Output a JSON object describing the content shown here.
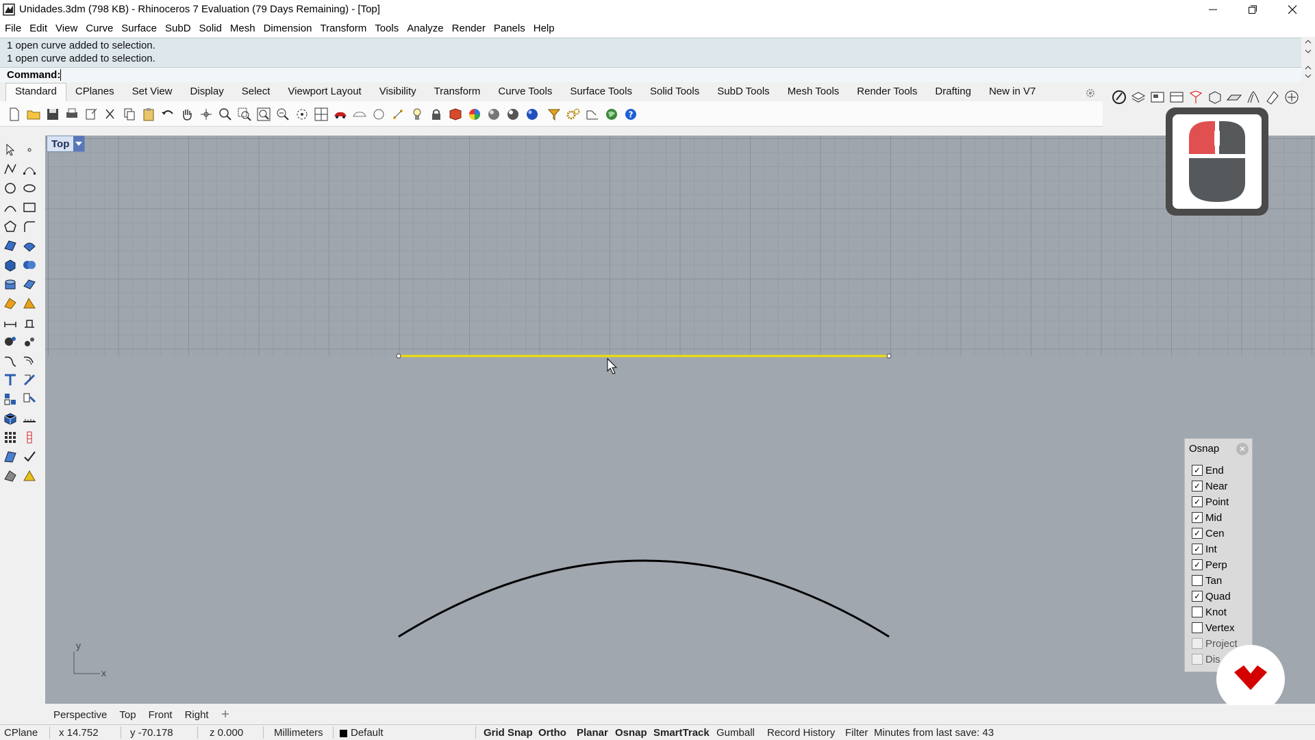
{
  "window": {
    "title": "Unidades.3dm (798 KB) - Rhinoceros 7 Evaluation (79 Days Remaining) - [Top]",
    "minimize_icon": "minimize-icon",
    "restore_icon": "restore-icon",
    "close_icon": "close-icon"
  },
  "menu": [
    "File",
    "Edit",
    "View",
    "Curve",
    "Surface",
    "SubD",
    "Solid",
    "Mesh",
    "Dimension",
    "Transform",
    "Tools",
    "Analyze",
    "Render",
    "Panels",
    "Help"
  ],
  "command": {
    "history": [
      "1 open curve added to selection.",
      "1 open curve added to selection."
    ],
    "label": "Command:",
    "value": ""
  },
  "toolbar_tabs": [
    "Standard",
    "CPlanes",
    "Set View",
    "Display",
    "Select",
    "Viewport Layout",
    "Visibility",
    "Transform",
    "Curve Tools",
    "Surface Tools",
    "Solid Tools",
    "SubD Tools",
    "Mesh Tools",
    "Render Tools",
    "Drafting",
    "New in V7"
  ],
  "active_toolbar_tab": "Standard",
  "viewport": {
    "label": "Top",
    "axis_x": "x",
    "axis_y": "y"
  },
  "osnap": {
    "title": "Osnap",
    "items": [
      {
        "label": "End",
        "checked": true
      },
      {
        "label": "Near",
        "checked": true
      },
      {
        "label": "Point",
        "checked": true
      },
      {
        "label": "Mid",
        "checked": true
      },
      {
        "label": "Cen",
        "checked": true
      },
      {
        "label": "Int",
        "checked": true
      },
      {
        "label": "Perp",
        "checked": true
      },
      {
        "label": "Tan",
        "checked": false
      },
      {
        "label": "Quad",
        "checked": true
      },
      {
        "label": "Knot",
        "checked": false
      },
      {
        "label": "Vertex",
        "checked": false
      },
      {
        "label": "Project",
        "checked": false,
        "disabled": true
      },
      {
        "label": "Dis",
        "checked": false,
        "disabled": true
      }
    ]
  },
  "view_tabs": [
    "Perspective",
    "Top",
    "Front",
    "Right"
  ],
  "status": {
    "cplane": "CPlane",
    "x": "x 14.752",
    "y": "y -70.178",
    "z": "z 0.000",
    "units": "Millimeters",
    "layer": "Default",
    "grid_snap": "Grid Snap",
    "ortho": "Ortho",
    "planar": "Planar",
    "osnap": "Osnap",
    "smarttrack": "SmartTrack",
    "gumball": "Gumball",
    "record_history": "Record History",
    "filter": "Filter",
    "save_info": "Minutes from last save: 43"
  },
  "colors": {
    "viewport_bg": "#a1a7af",
    "selected_curve": "#f2e000",
    "curve": "#000000",
    "rhino_red": "#d40000"
  }
}
